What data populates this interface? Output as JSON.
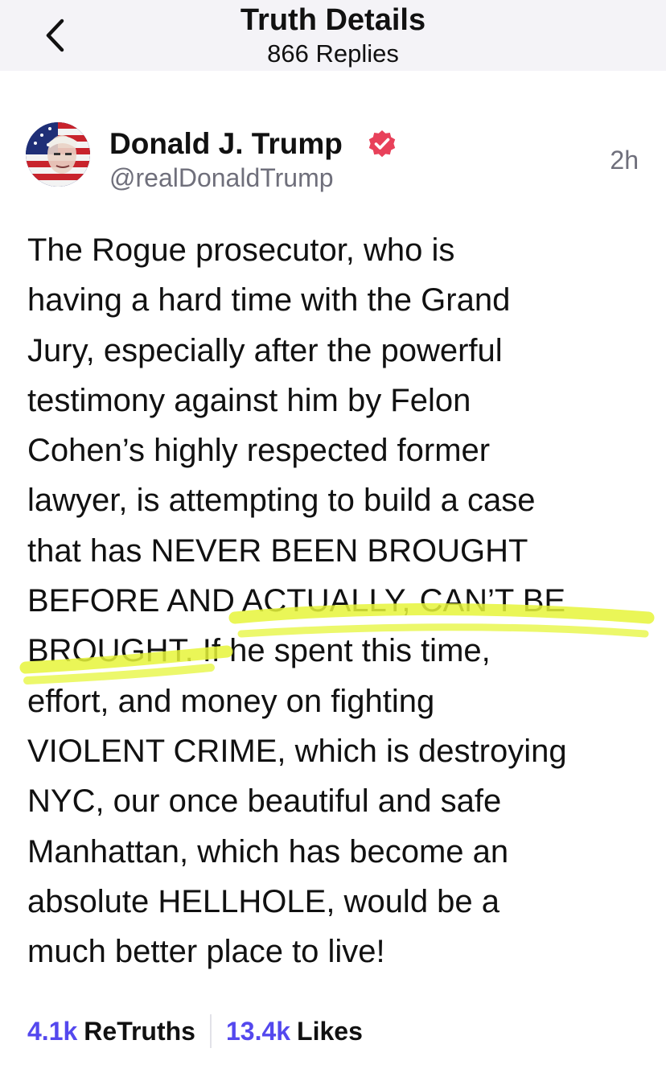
{
  "header": {
    "title": "Truth Details",
    "replies": "866 Replies"
  },
  "post": {
    "author_name": "Donald J. Trump",
    "author_handle": "@realDonaldTrump",
    "time": "2h",
    "verified": true,
    "lines": [
      "The Rogue prosecutor, who is",
      "having a hard time with the Grand",
      "Jury, especially after the powerful",
      "testimony against him by Felon",
      "Cohen’s highly respected former",
      "lawyer, is attempting to build a case",
      "that has NEVER BEEN BROUGHT",
      "BEFORE AND ACTUALLY, CAN’T BE",
      "BROUGHT. If he spent this time,",
      "effort, and money on fighting",
      "VIOLENT CRIME, which is destroying",
      "NYC, our once beautiful and safe",
      "Manhattan, which has become an",
      "absolute HELLHOLE, would be a",
      "much better place to live!"
    ]
  },
  "stats": {
    "retruths_count": "4.1k",
    "retruths_label": "ReTruths",
    "likes_count": "13.4k",
    "likes_label": "Likes"
  },
  "icons": {
    "back": "chevron-left-icon",
    "verified": "verified-badge-icon"
  },
  "colors": {
    "accent": "#5448ee",
    "verified": "#e8415a",
    "highlighter": "#e6f53a",
    "header_bg": "#f4f3f7",
    "muted_text": "#6f6f7b"
  }
}
